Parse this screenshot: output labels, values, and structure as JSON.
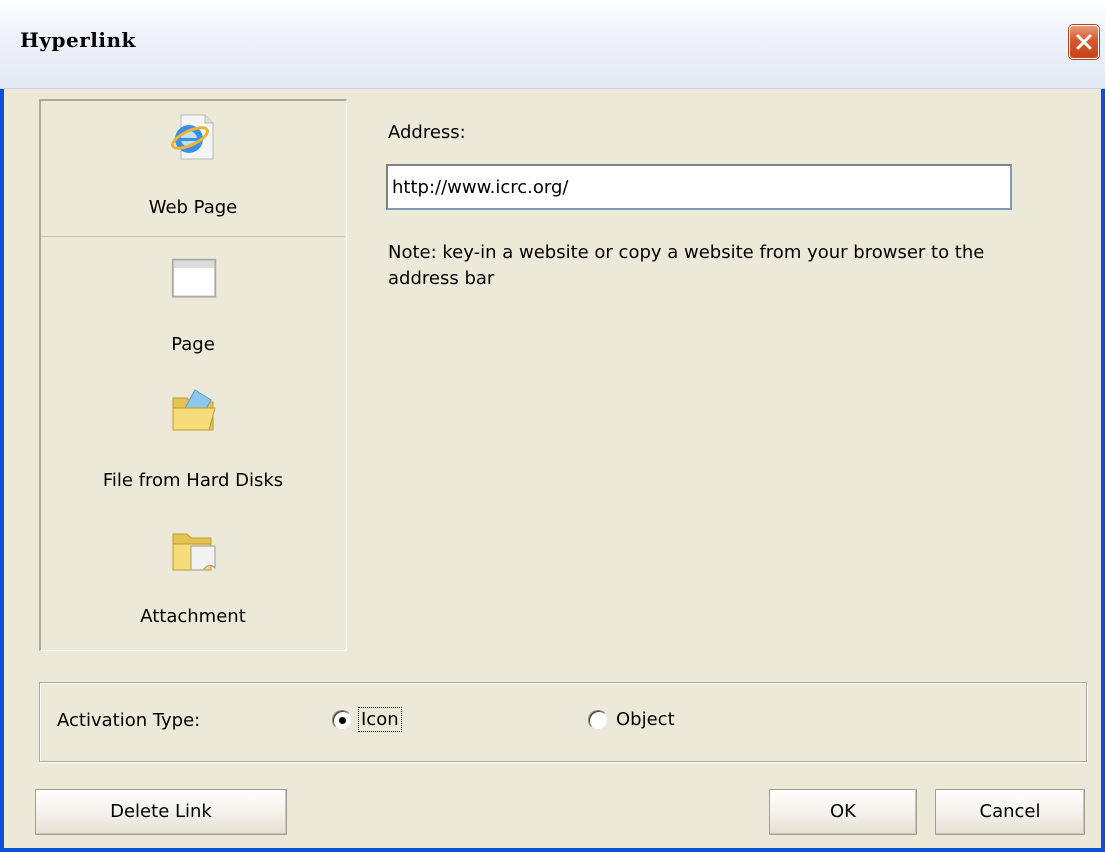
{
  "window": {
    "title": "Hyperlink"
  },
  "nav": {
    "items": [
      {
        "label": "Web Page",
        "icon": "web-page-icon",
        "selected": true
      },
      {
        "label": "Page",
        "icon": "page-icon",
        "selected": false
      },
      {
        "label": "File from Hard Disks",
        "icon": "folder-icon",
        "selected": false
      },
      {
        "label": "Attachment",
        "icon": "attachment-folder-icon",
        "selected": false
      }
    ]
  },
  "address": {
    "label": "Address:",
    "value": "http://www.icrc.org/"
  },
  "note": "Note: key-in a website or copy a website from your browser to the address bar",
  "activation": {
    "label": "Activation Type:",
    "options": [
      {
        "label": "Icon",
        "checked": true
      },
      {
        "label": "Object",
        "checked": false
      }
    ]
  },
  "buttons": {
    "delete_link": "Delete Link",
    "ok": "OK",
    "cancel": "Cancel"
  },
  "colors": {
    "title_border": "#0a50d8",
    "dialog_bg": "#ece9d8",
    "close_button": "#d55a2d"
  }
}
